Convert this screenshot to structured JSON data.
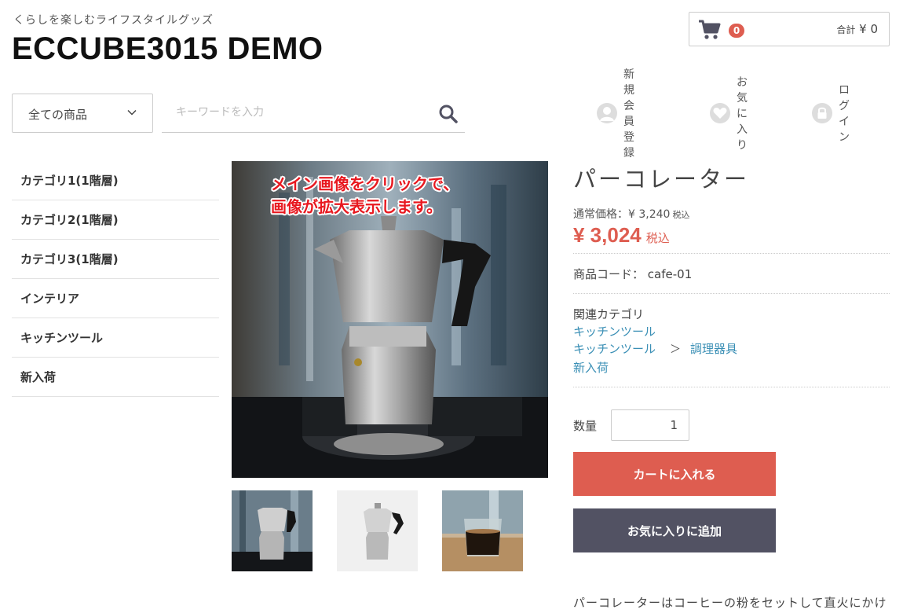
{
  "header": {
    "tagline": "くらしを楽しむライフスタイルグッズ",
    "shop_title": "ECCUBE3015 DEMO",
    "cart": {
      "count": "0",
      "total_label": "合計",
      "total_value": "¥ 0"
    }
  },
  "search": {
    "category_value": "全ての商品",
    "placeholder": "キーワードを入力"
  },
  "header_links": [
    {
      "label": "新規会員登録",
      "icon": "user-icon"
    },
    {
      "label": "お気に入り",
      "icon": "heart-icon"
    },
    {
      "label": "ログイン",
      "icon": "lock-icon"
    }
  ],
  "sidebar": {
    "items": [
      {
        "label": "カテゴリ1(1階層)"
      },
      {
        "label": "カテゴリ2(1階層)"
      },
      {
        "label": "カテゴリ3(1階層)"
      },
      {
        "label": "インテリア"
      },
      {
        "label": "キッチンツール"
      },
      {
        "label": "新入荷"
      }
    ]
  },
  "gallery": {
    "overlay_line1": "メイン画像をクリックで、",
    "overlay_line2": "画像が拡大表示します。"
  },
  "product": {
    "name": "パーコレーター",
    "regular_price_label": "通常価格：",
    "regular_price": "¥ 3,240",
    "regular_tax": "税込",
    "price": "¥ 3,024",
    "price_tax": "税込",
    "code_label": "商品コード：",
    "code": "cafe-01",
    "related_title": "関連カテゴリ",
    "related": {
      "line1": "キッチンツール",
      "line2_parent": "キッチンツール",
      "line2_sep": "＞",
      "line2_child": "調理器具",
      "line3": "新入荷"
    },
    "qty_label": "数量",
    "qty_value": "1",
    "add_to_cart": "カートに入れる",
    "add_to_favorites": "お気に入りに追加",
    "description": "パーコレーターはコーヒーの粉をセットして直火にかけ"
  },
  "colors": {
    "accent_red": "#de5d50",
    "dark_button": "#525263",
    "link_blue": "#3a8fb5"
  }
}
